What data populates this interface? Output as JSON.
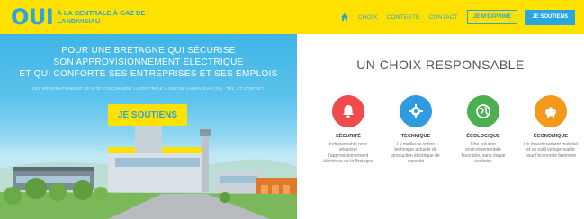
{
  "header": {
    "logo_big": "OUI",
    "logo_small": "À la centrale à gaz de Landivisiau",
    "nav": [
      "Choix",
      "Contexte",
      "Contact"
    ],
    "btn_outline": "Je m'exprime",
    "btn_solid": "Je soutiens",
    "home_icon": "home-icon"
  },
  "hero": {
    "line1": "Pour une Bretagne qui sécurise",
    "line2": "son approvisionnement électrique",
    "line3": "et qui conforte ses entreprises et ses emplois",
    "subtext": "Les informations de ce site concernent la centrale à gaz de Landivisiau (29) · Tél. et contact",
    "cta": "Je soutiens"
  },
  "main": {
    "title": "Un choix responsable",
    "features": [
      {
        "title": "Sécurité",
        "desc": "Indispensable pour sécuriser l'approvisionnement électrique de la Bretagne",
        "color": "#ef4b4b",
        "icon": "bell-icon"
      },
      {
        "title": "Technique",
        "desc": "La meilleure option technique actuelle de production électrique de capacité",
        "color": "#2f9be0",
        "icon": "gear-icon"
      },
      {
        "title": "Écologique",
        "desc": "Une solution environnementale favorable, sans risque sanitaire",
        "color": "#4caf50",
        "icon": "globe-icon"
      },
      {
        "title": "Économique",
        "desc": "Un investissement matériel et un outil indispensable pour l'économie bretonne",
        "color": "#f39a1c",
        "icon": "piggy-bank-icon"
      }
    ]
  }
}
